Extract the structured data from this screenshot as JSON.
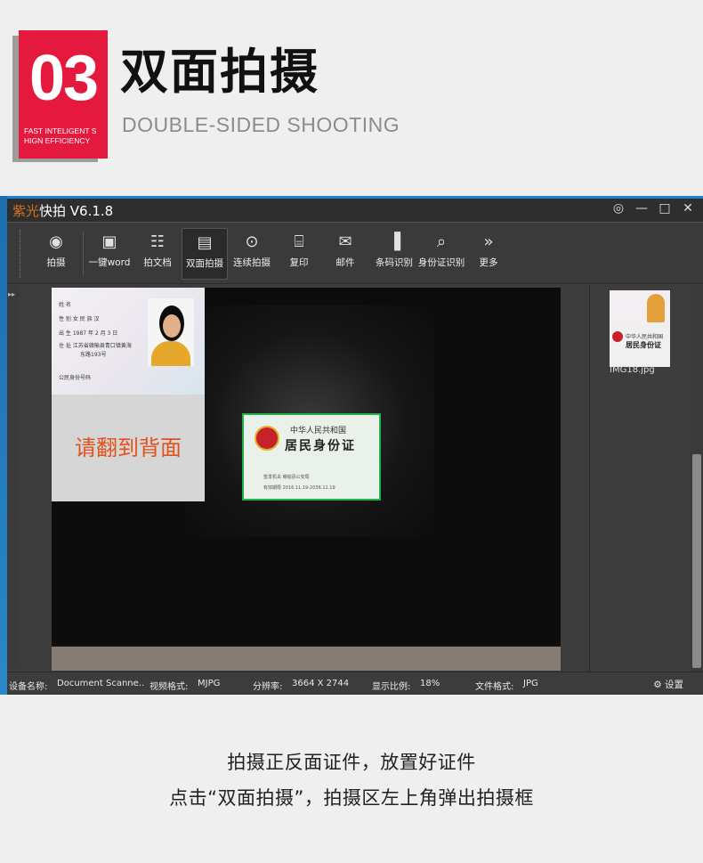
{
  "badge": {
    "number": "03",
    "subtitle_line1": "FAST INTELIGENT S",
    "subtitle_line2": "HIGN EFFICIENCY"
  },
  "header": {
    "title": "双面拍摄",
    "subtitle": "DOUBLE-SIDED SHOOTING"
  },
  "app": {
    "title_brand": "紫光",
    "title_rest": "快拍 V6.1.8",
    "window_controls": [
      "globe-icon",
      "minimize-icon",
      "maximize-icon",
      "close-icon"
    ],
    "toolbar": [
      {
        "label": "拍摄",
        "icon": "camera-lens-icon"
      },
      {
        "label": "一键word",
        "icon": "camera-icon"
      },
      {
        "label": "拍文档",
        "icon": "document-icon"
      },
      {
        "label": "双面拍摄",
        "icon": "id-card-icon"
      },
      {
        "label": "连续拍摄",
        "icon": "continuous-shoot-icon"
      },
      {
        "label": "复印",
        "icon": "copy-icon"
      },
      {
        "label": "邮件",
        "icon": "mail-icon"
      },
      {
        "label": "条码识别",
        "icon": "barcode-icon"
      },
      {
        "label": "身份证识别",
        "icon": "id-recognition-icon"
      },
      {
        "label": "更多",
        "icon": "chevron-right-double-icon"
      }
    ],
    "popup": {
      "front_lines": [
        "姓 名",
        "性 别  女  民 族 汉",
        "出 生  1987 年 2 月 3 日",
        "住 址  江苏省赣榆县青口镇黄海",
        "东路193号",
        "公民身份号码"
      ],
      "back_prompt": "请翻到背面"
    },
    "id_card": {
      "line1": "中华人民共和国",
      "line2": "居民身份证",
      "line3": "签发机关  赣榆县公安局",
      "line4": "有效期限  2016.11.19-2036.11.19"
    },
    "thumbnail": {
      "filename": "IMG18.jpg",
      "back_line1": "中华人民共和国",
      "back_line2": "居民身份证"
    },
    "status": {
      "device_label": "设备名称:",
      "device_value": "Document Scanne..",
      "video_label": "视频格式:",
      "video_value": "MJPG",
      "res_label": "分辨率:",
      "res_value": "3664 X 2744",
      "ratio_label": "显示比例:",
      "ratio_value": "18%",
      "file_label": "文件格式:",
      "file_value": "JPG",
      "settings_label": "设置"
    }
  },
  "captions": {
    "line1": "拍摄正反面证件，放置好证件",
    "line2": "点击“双面拍摄”，拍摄区左上角弹出拍摄框"
  }
}
